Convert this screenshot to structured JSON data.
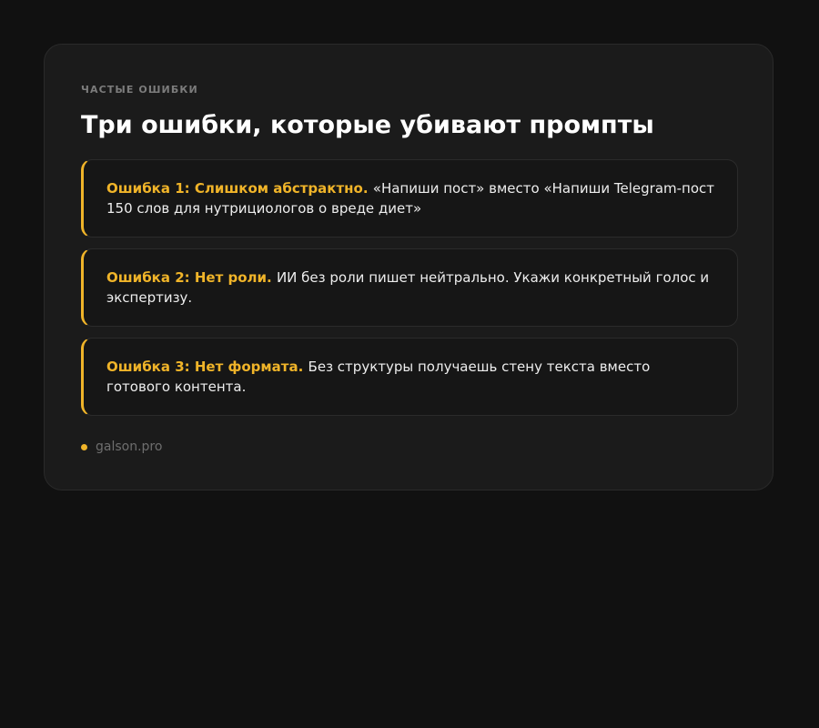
{
  "kicker": "ЧАСТЫЕ ОШИБКИ",
  "title": "Три ошибки, которые убивают промпты",
  "mistakes": [
    {
      "label": "Ошибка 1: Слишком абстрактно.",
      "text": "«Напиши пост» вместо «Напиши Telegram-пост 150 слов для нутрициологов о вреде диет»"
    },
    {
      "label": "Ошибка 2: Нет роли.",
      "text": "ИИ без роли пишет нейтрально. Укажи конкретный голос и экспертизу."
    },
    {
      "label": "Ошибка 3: Нет формата.",
      "text": "Без структуры получаешь стену текста вместо готового контента."
    }
  ],
  "footer": {
    "site": "galson.pro"
  },
  "colors": {
    "background": "#111111",
    "card": "#1b1b1b",
    "accent": "#f0b429",
    "text": "#ededed",
    "muted": "#7c7c7c"
  }
}
